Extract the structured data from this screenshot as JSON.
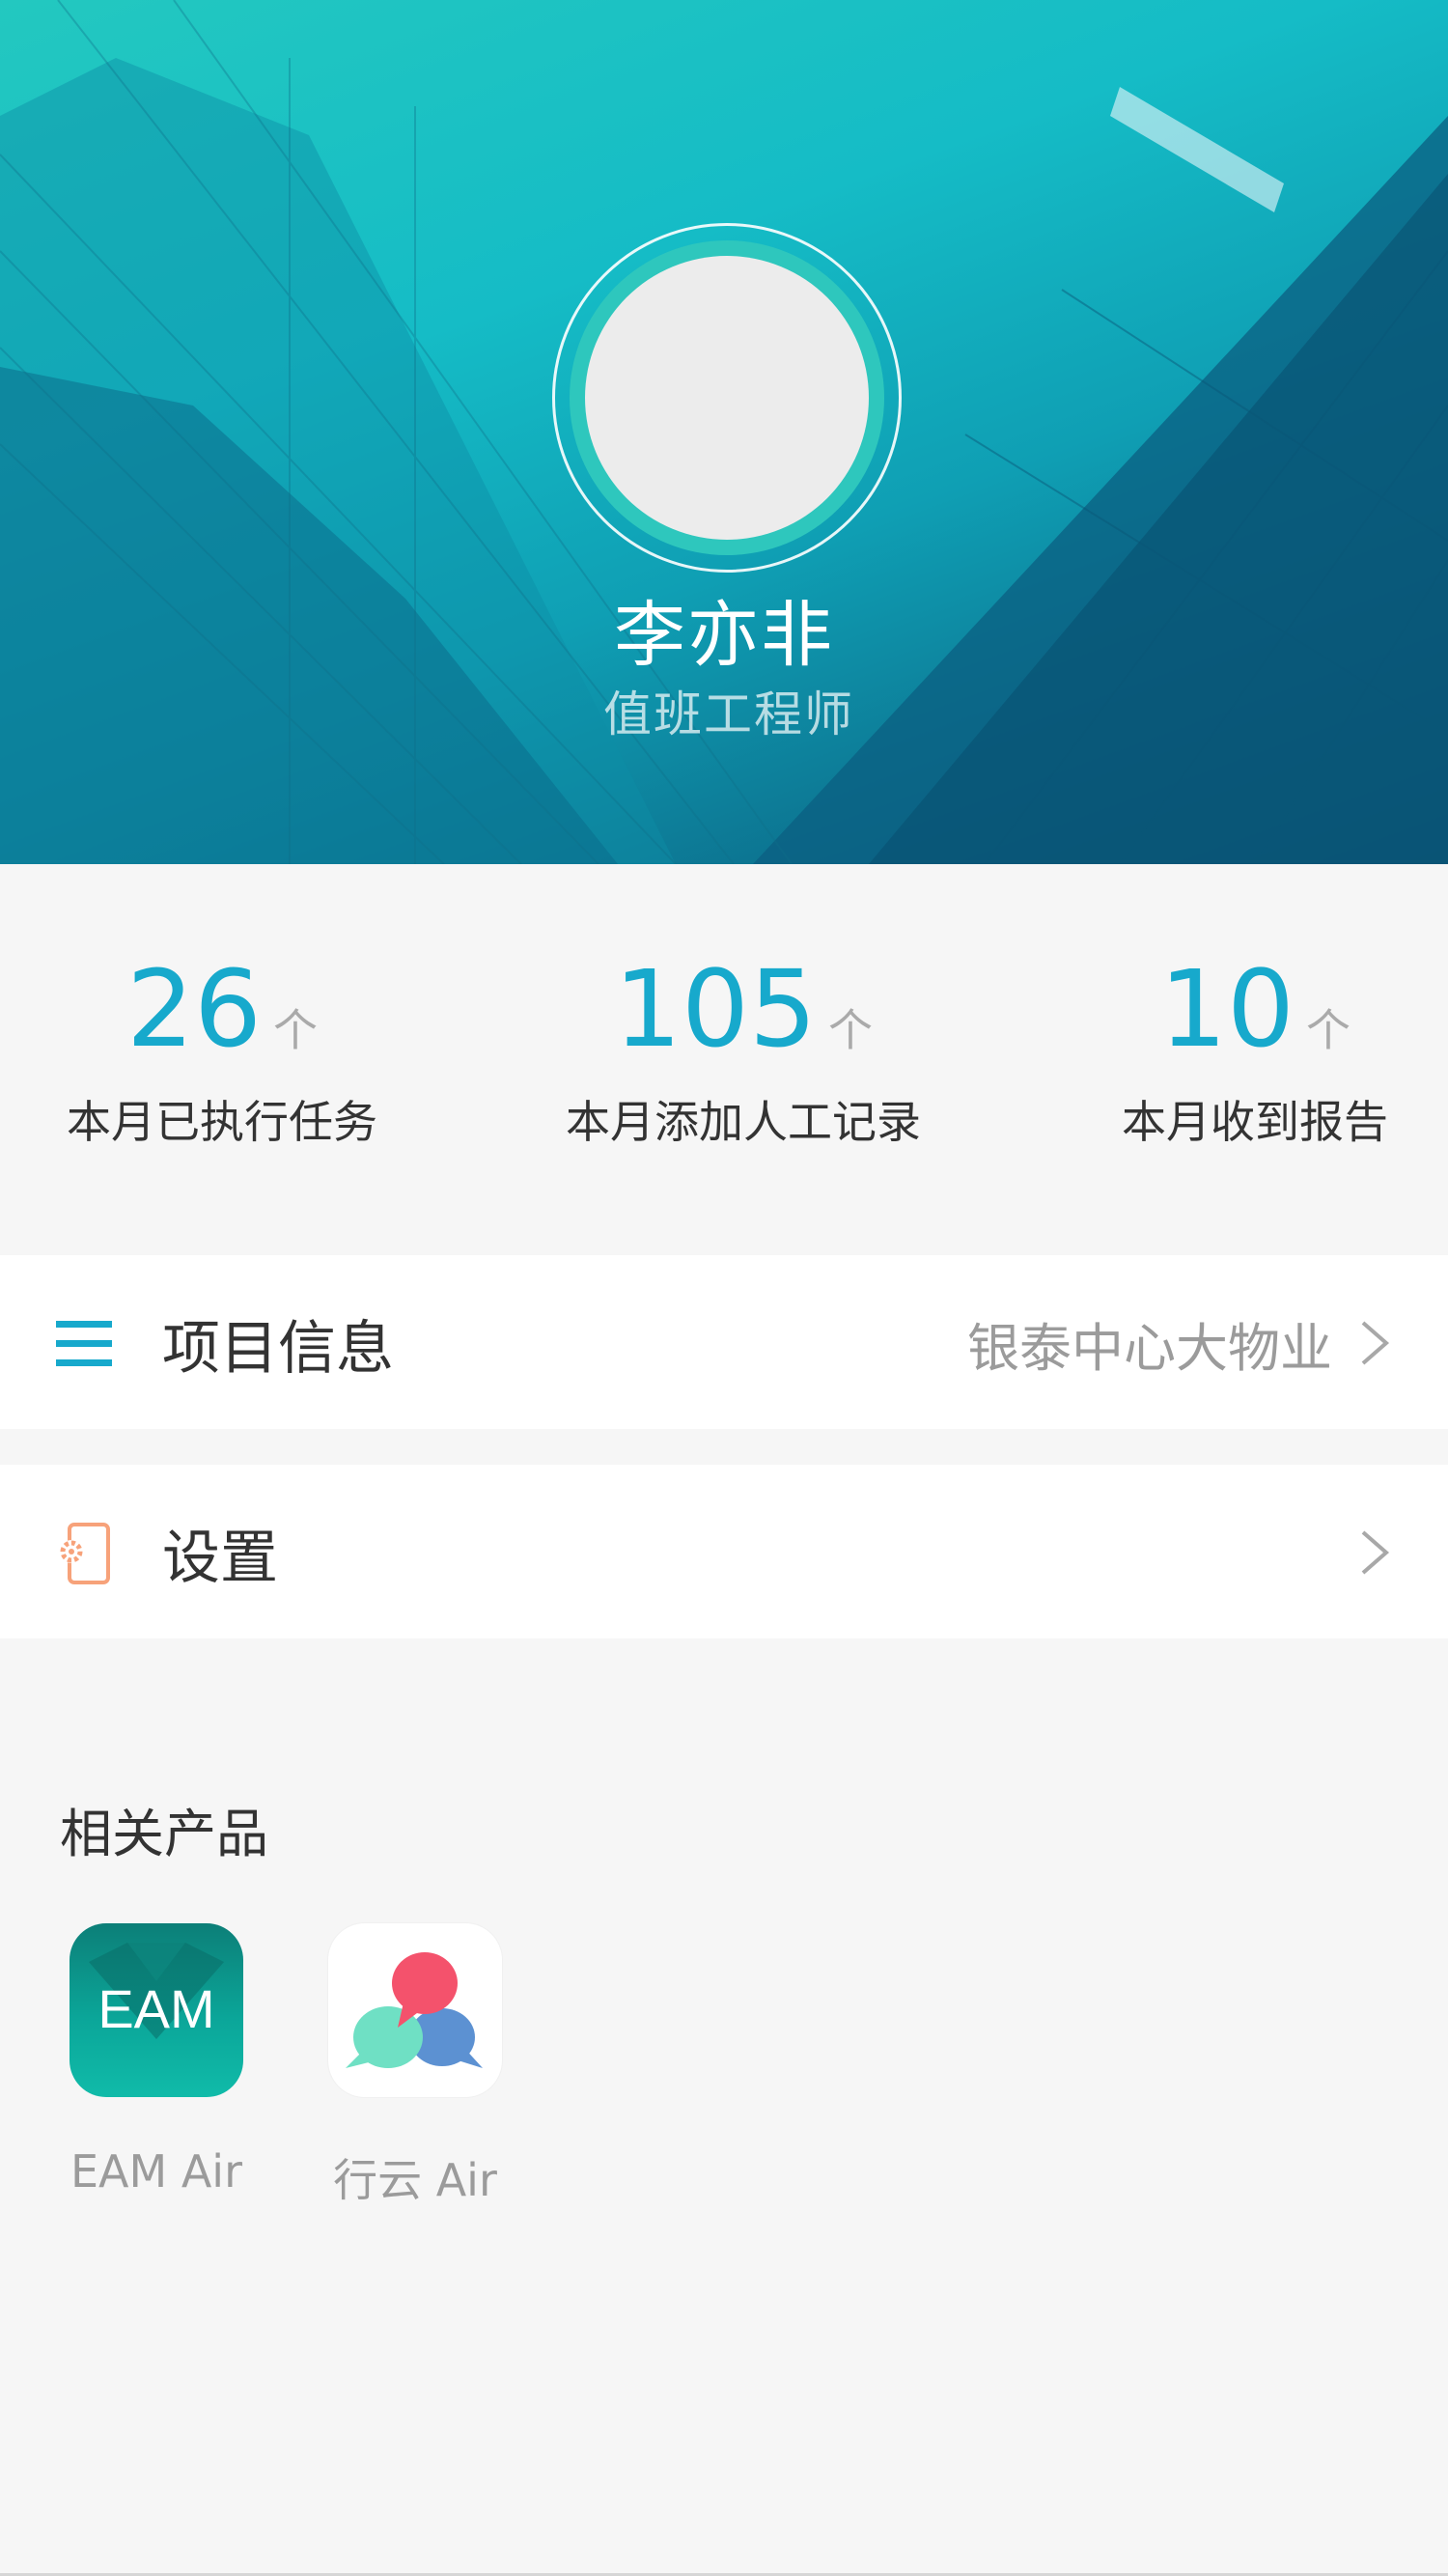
{
  "profile": {
    "name": "李亦非",
    "role": "值班工程师"
  },
  "stats": [
    {
      "value": "26",
      "unit": "个",
      "label": "本月已执行任务"
    },
    {
      "value": "105",
      "unit": "个",
      "label": "本月添加人工记录"
    },
    {
      "value": "10",
      "unit": "个",
      "label": "本月收到报告"
    }
  ],
  "menu": {
    "project": {
      "title": "项目信息",
      "value": "银泰中心大物业",
      "icon": "list-icon"
    },
    "settings": {
      "title": "设置",
      "icon": "settings-phone-icon"
    }
  },
  "related": {
    "title": "相关产品",
    "products": [
      {
        "icon_text": "EAM",
        "label": "EAM Air",
        "icon": "eam-app-icon"
      },
      {
        "label": "行云 Air",
        "icon": "chat-bubbles-app-icon"
      }
    ]
  },
  "colors": {
    "accent": "#17a9cc",
    "settings_icon": "#f7a27a",
    "chat_pink": "#f4526c",
    "chat_mint": "#6fe0c4",
    "chat_blue": "#5c91d2"
  }
}
